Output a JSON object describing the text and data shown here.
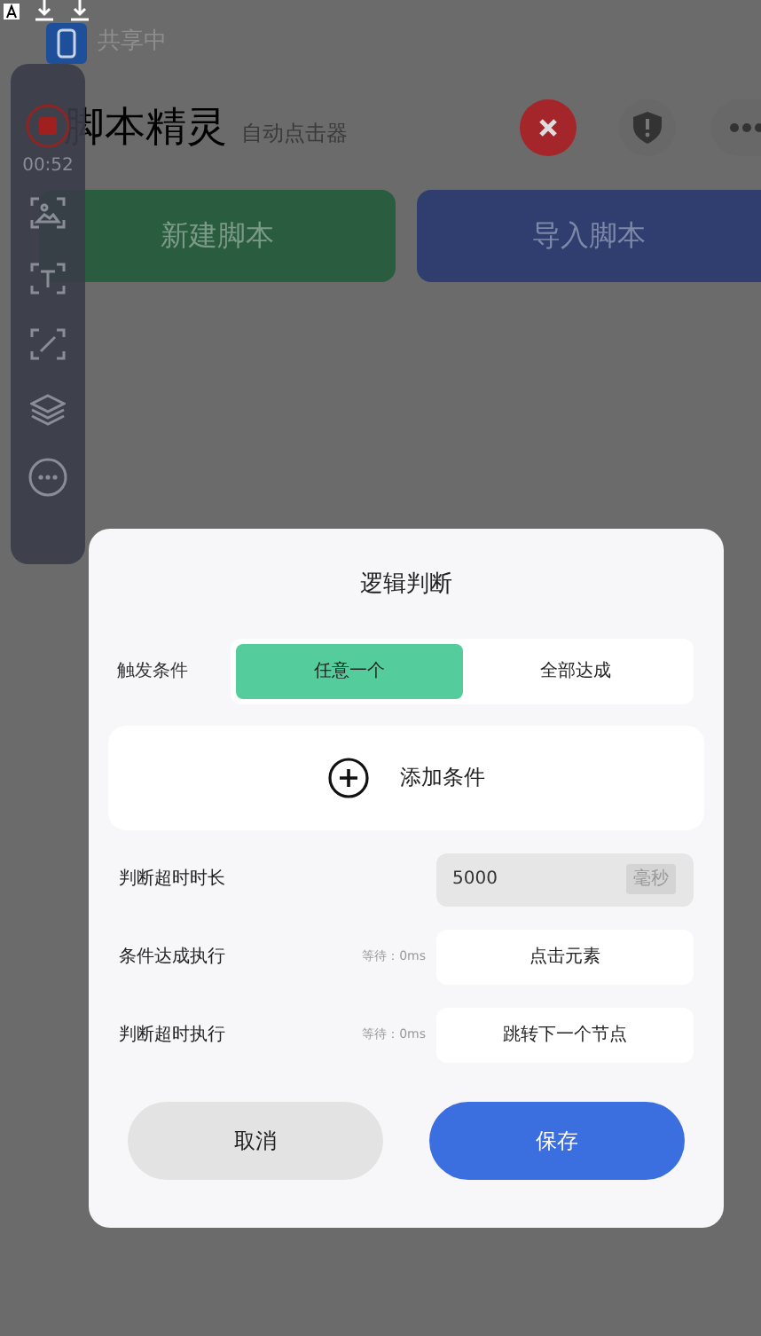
{
  "status_bar": {
    "sharing_label": "共享中"
  },
  "floating_toolbar": {
    "timer": "00:52"
  },
  "app": {
    "title": "脚本精灵",
    "subtitle": "自动点击器",
    "buttons": [
      {
        "label": "新建脚本",
        "kind": "create"
      },
      {
        "label": "导入脚本",
        "kind": "import"
      }
    ]
  },
  "dialog": {
    "title": "逻辑判断",
    "trigger": {
      "label": "触发条件",
      "options": [
        {
          "label": "任意一个",
          "selected": true
        },
        {
          "label": "全部达成",
          "selected": false
        }
      ]
    },
    "add_condition": {
      "label": "添加条件"
    },
    "timeout": {
      "label": "判断超时时长",
      "value": "5000",
      "unit": "毫秒"
    },
    "actions": [
      {
        "label": "条件达成执行",
        "wait": "等待：0ms",
        "action": "点击元素"
      },
      {
        "label": "判断超时执行",
        "wait": "等待：0ms",
        "action": "跳转下一个节点"
      }
    ],
    "buttons": [
      {
        "label": "取消",
        "kind": "cancel"
      },
      {
        "label": "保存",
        "kind": "save"
      }
    ]
  }
}
